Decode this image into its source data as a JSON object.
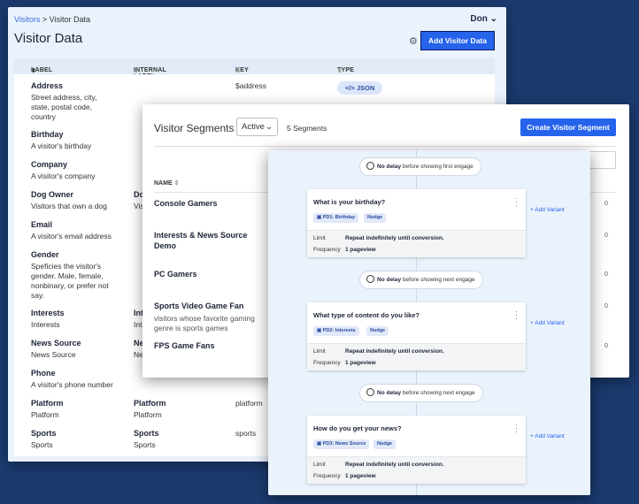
{
  "visitor_data": {
    "breadcrumb": {
      "link": "Visitors",
      "sep": ">",
      "current": "Visitor Data"
    },
    "user": "Don",
    "title": "Visitor Data",
    "add_button": "Add Visitor Data",
    "columns": [
      "LABEL",
      "INTERNAL LABEL",
      "KEY",
      "TYPE"
    ],
    "rows": [
      {
        "label": "Address",
        "desc": "Street address, city, state, postal code, country",
        "internal": "",
        "internal_desc": "",
        "key": "$address",
        "type": "JSON"
      },
      {
        "label": "Birthday",
        "desc": "A visitor's birthday",
        "internal": "",
        "internal_desc": "",
        "key": "",
        "type": ""
      },
      {
        "label": "Company",
        "desc": "A visitor's company",
        "internal": "",
        "internal_desc": "",
        "key": "",
        "type": ""
      },
      {
        "label": "Dog Owner",
        "desc": "Visitors that own a dog",
        "internal": "Do",
        "internal_desc": "Vis",
        "key": "",
        "type": ""
      },
      {
        "label": "Email",
        "desc": "A visitor's email address",
        "internal": "",
        "internal_desc": "",
        "key": "",
        "type": ""
      },
      {
        "label": "Gender",
        "desc": "Speficies the visitor's gender. Male, female, nonbinary, or prefer not say.",
        "internal": "",
        "internal_desc": "",
        "key": "",
        "type": ""
      },
      {
        "label": "Interests",
        "desc": "Interests",
        "internal": "Int",
        "internal_desc": "Int",
        "key": "",
        "type": ""
      },
      {
        "label": "News Source",
        "desc": "News Source",
        "internal": "Ne",
        "internal_desc": "Ne",
        "key": "",
        "type": ""
      },
      {
        "label": "Phone",
        "desc": "A visitor's phone number",
        "internal": "",
        "internal_desc": "",
        "key": "",
        "type": ""
      },
      {
        "label": "Platform",
        "desc": "Platform",
        "internal": "Platform",
        "internal_desc": "Platform",
        "key": "platform",
        "type": ""
      },
      {
        "label": "Sports",
        "desc": "Sports",
        "internal": "Sports",
        "internal_desc": "Sports",
        "key": "sports",
        "type": ""
      }
    ]
  },
  "segments": {
    "title": "Visitor Segments",
    "filter": "Active",
    "count": "5 Segments",
    "create_button": "Create Visitor Segment",
    "name_header": "NAME",
    "items": [
      {
        "name": "Console Gamers",
        "desc": ""
      },
      {
        "name": "Interests & News Source Demo",
        "desc": ""
      },
      {
        "name": "PC Gamers",
        "desc": ""
      },
      {
        "name": "Sports Video Game Fan",
        "desc": "visitors whose favorite gaming genre is sports games"
      },
      {
        "name": "FPS Game Fans",
        "desc": ""
      }
    ],
    "right_numbers": [
      "0",
      "0",
      "0",
      "0",
      "0"
    ]
  },
  "flow": {
    "delays": [
      {
        "strong": "No delay",
        "rest": "before showing first engage"
      },
      {
        "strong": "No delay",
        "rest": "before showing next engage"
      },
      {
        "strong": "No delay",
        "rest": "before showing next engage"
      }
    ],
    "steps": [
      {
        "question": "What is your birthday?",
        "tag1": "PD1: Birthday",
        "tag2": "Nudge",
        "limit_label": "Limit",
        "limit": "Repeat indefinitely until conversion.",
        "freq_label": "Frequency",
        "freq": "1 pageview",
        "add_variant": "+ Add Variant"
      },
      {
        "question": "What type of content do you like?",
        "tag1": "PD2: Interests",
        "tag2": "Nudge",
        "limit_label": "Limit",
        "limit": "Repeat indefinitely until conversion.",
        "freq_label": "Frequency",
        "freq": "1 pageview",
        "add_variant": "+ Add Variant"
      },
      {
        "question": "How do you get your news?",
        "tag1": "PD3: News Source",
        "tag2": "Nudge",
        "limit_label": "Limit",
        "limit": "Repeat indefinitely until conversion.",
        "freq_label": "Frequency",
        "freq": "1 pageview",
        "add_variant": "+ Add Variant"
      }
    ]
  },
  "colors": {
    "background": "#1b3a6e",
    "accent": "#2563eb",
    "panel": "#eaf2fc"
  }
}
